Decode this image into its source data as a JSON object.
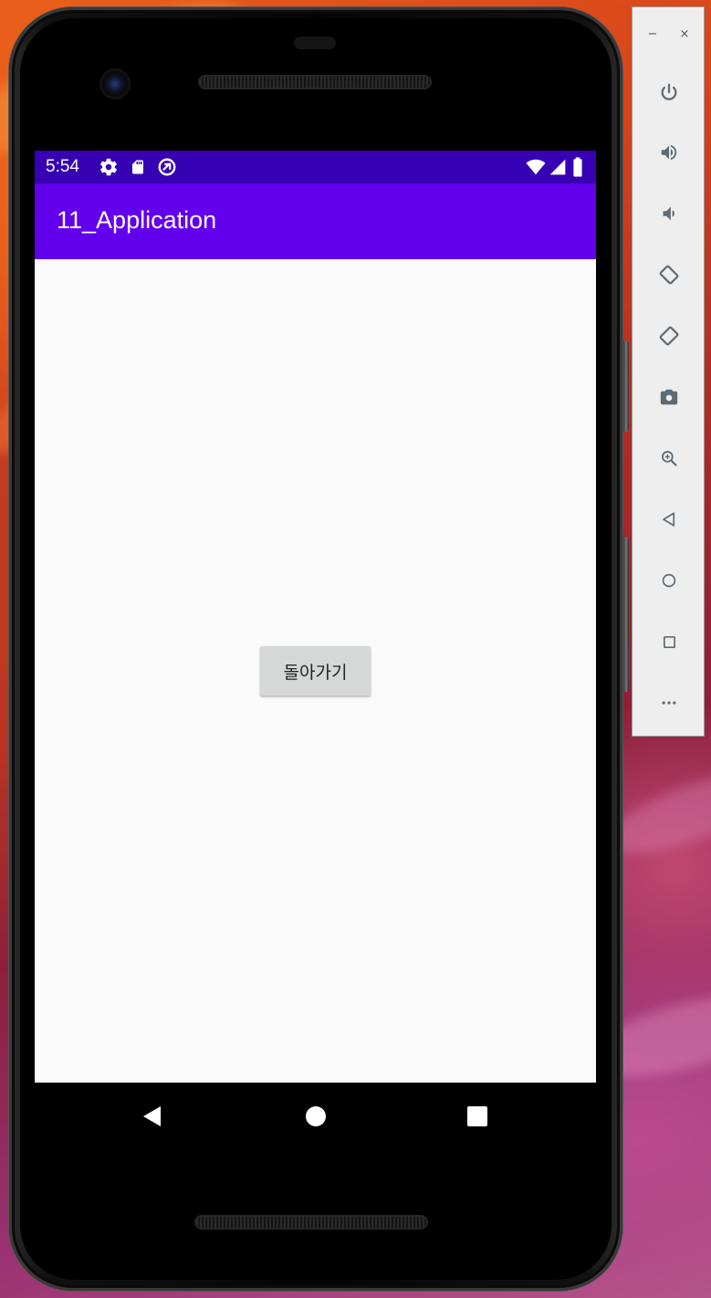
{
  "status_bar": {
    "time": "5:54",
    "background": "#3700b3",
    "left_icons": [
      "gear-icon",
      "sd-card-icon",
      "data-saver-icon"
    ],
    "right_icons": [
      "wifi-icon",
      "cell-signal-icon",
      "battery-icon"
    ]
  },
  "app_bar": {
    "title": "11_Application",
    "background": "#6200ee"
  },
  "content": {
    "back_button_label": "돌아가기",
    "button_background": "#d6d7d7",
    "screen_background": "#fafafa"
  },
  "nav_bar": {
    "buttons": [
      "back-triangle-icon",
      "home-circle-icon",
      "recents-square-icon"
    ]
  },
  "emulator_panel": {
    "window_controls": {
      "minimize": "−",
      "close": "×"
    },
    "tools": [
      "power-icon",
      "volume-up-icon",
      "volume-down-icon",
      "rotate-left-icon",
      "rotate-right-icon",
      "camera-icon",
      "zoom-icon",
      "back-icon",
      "home-icon",
      "overview-icon",
      "more-icon"
    ]
  }
}
